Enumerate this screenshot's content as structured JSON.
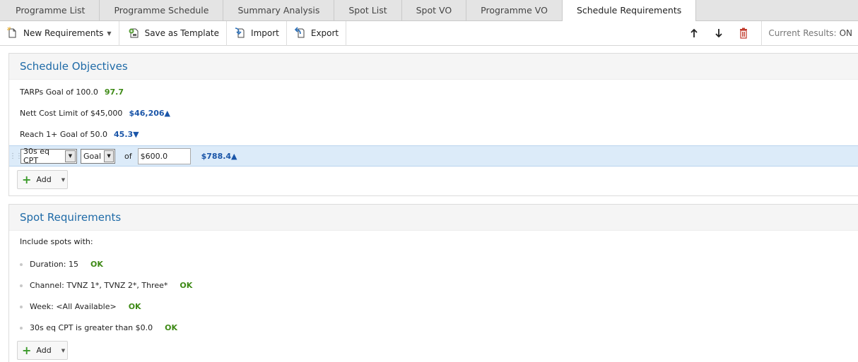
{
  "tabs": [
    {
      "label": "Programme List"
    },
    {
      "label": "Programme Schedule"
    },
    {
      "label": "Summary Analysis"
    },
    {
      "label": "Spot List"
    },
    {
      "label": "Spot VO"
    },
    {
      "label": "Programme VO"
    },
    {
      "label": "Schedule Requirements",
      "active": true
    }
  ],
  "toolbar": {
    "new_requirements": "New Requirements",
    "save_as_template": "Save as Template",
    "import": "Import",
    "export": "Export",
    "current_results_label": "Current Results:",
    "current_results_value": "ON",
    "icons": [
      "new-document-icon",
      "save-template-icon",
      "import-icon",
      "export-icon",
      "arrow-up-icon",
      "arrow-down-icon",
      "trash-icon"
    ]
  },
  "objectives": {
    "title": "Schedule Objectives",
    "items": [
      {
        "label": "TARPs Goal of 100.0",
        "value": "97.7"
      },
      {
        "label": "Nett Cost Limit of $45,000",
        "value": "$46,206▲"
      },
      {
        "label": "Reach 1+ Goal of 50.0",
        "value": "45.3▼"
      }
    ],
    "edit": {
      "metric": "30s eq CPT",
      "type": "Goal",
      "of_label": "of",
      "amount": "$600.0",
      "value": "$788.4▲"
    },
    "add_label": "Add"
  },
  "spot_requirements": {
    "title": "Spot Requirements",
    "intro": "Include spots with:",
    "items": [
      {
        "label": "Duration: 15",
        "status": "OK"
      },
      {
        "label": "Channel: TVNZ 1*, TVNZ 2*, Three*",
        "status": "OK"
      },
      {
        "label": "Week: <All Available>",
        "status": "OK"
      },
      {
        "label": "30s eq CPT is greater than $0.0",
        "status": "OK"
      }
    ],
    "add_label": "Add"
  },
  "colors": {
    "accent": "#1e6aa7",
    "ok_green": "#3e8a16",
    "value_blue": "#1a55a8",
    "delete_red": "#c0392b",
    "edit_row_bg": "#dcebf9"
  }
}
